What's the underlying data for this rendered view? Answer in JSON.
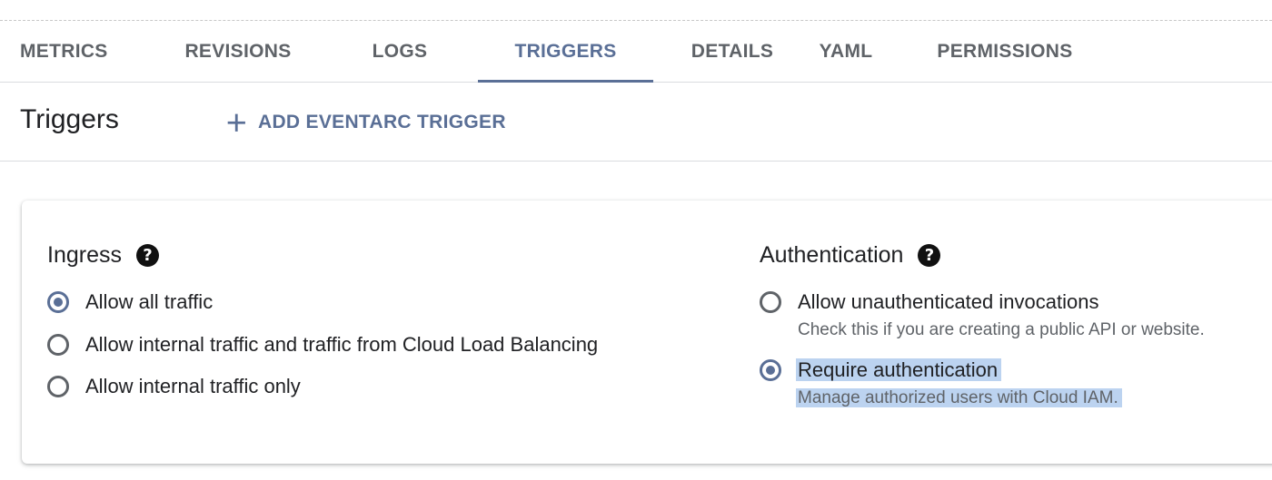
{
  "tabs": [
    {
      "label": "METRICS",
      "active": false
    },
    {
      "label": "REVISIONS",
      "active": false
    },
    {
      "label": "LOGS",
      "active": false
    },
    {
      "label": "TRIGGERS",
      "active": true
    },
    {
      "label": "DETAILS",
      "active": false
    },
    {
      "label": "YAML",
      "active": false
    },
    {
      "label": "PERMISSIONS",
      "active": false
    }
  ],
  "header": {
    "title": "Triggers",
    "add_button_label": "ADD EVENTARC TRIGGER",
    "add_button_icon": "plus-icon"
  },
  "ingress": {
    "title": "Ingress",
    "help_icon": "help-icon",
    "options": [
      {
        "label": "Allow all traffic",
        "checked": true
      },
      {
        "label": "Allow internal traffic and traffic from Cloud Load Balancing",
        "checked": false
      },
      {
        "label": "Allow internal traffic only",
        "checked": false
      }
    ]
  },
  "authentication": {
    "title": "Authentication",
    "help_icon": "help-icon",
    "options": [
      {
        "label": "Allow unauthenticated invocations",
        "description": "Check this if you are creating a public API or website.",
        "checked": false
      },
      {
        "label": "Require authentication",
        "description": "Manage authorized users with Cloud IAM.",
        "checked": true
      }
    ]
  },
  "colors": {
    "accent": "#5a6f96",
    "text": "#202124",
    "secondary_text": "#5f6368",
    "selection_highlight": "#bcd3f0"
  }
}
